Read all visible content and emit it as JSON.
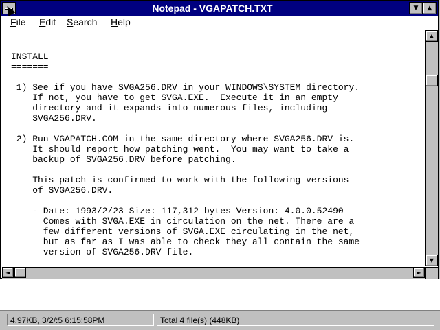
{
  "window": {
    "title": "Notepad - VGAPATCH.TXT"
  },
  "menubar": {
    "file": "File",
    "edit": "Edit",
    "search": "Search",
    "help": "Help"
  },
  "editor": {
    "text": "INSTALL\n=======\n\n 1) See if you have SVGA256.DRV in your WINDOWS\\SYSTEM directory.\n    If not, you have to get SVGA.EXE.  Execute it in an empty\n    directory and it expands into numerous files, including\n    SVGA256.DRV.\n\n 2) Run VGAPATCH.COM in the same directory where SVGA256.DRV is.\n    It should report how patching went.  You may want to take a\n    backup of SVGA256.DRV before patching.\n\n    This patch is confirmed to work with the following versions\n    of SVGA256.DRV.\n\n    - Date: 1993/2/23 Size: 117,312 bytes Version: 4.0.0.52490\n      Comes with SVGA.EXE in circulation on the net. There are a\n      few different versions of SVGA.EXE circulating in the net,\n      but as far as I was able to check they all contain the same\n      version of SVGA256.DRV file."
  },
  "statusbar": {
    "selection_info": "4.97KB, 3/2/:5 6:15:58PM",
    "total_info": "Total 4 file(s) (448KB)"
  },
  "icons": {
    "system_menu": "system-menu-icon",
    "minimize": "minimize-arrow-icon",
    "maximize": "maximize-arrow-icon"
  },
  "colors": {
    "titlebar": "#000080",
    "chrome": "#c0c0c0"
  }
}
